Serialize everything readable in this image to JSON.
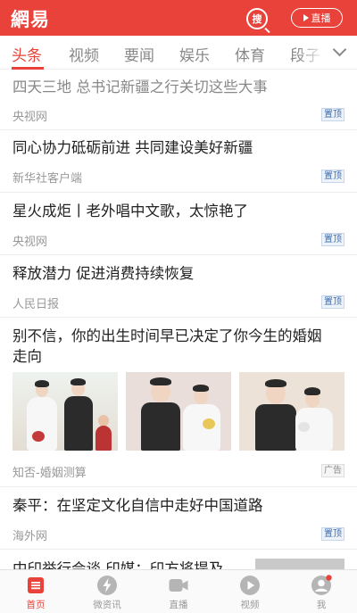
{
  "header": {
    "logo": "網易",
    "search_label": "搜",
    "live_label": "直播",
    "brand_color": "#e8423a"
  },
  "tabs": [
    {
      "label": "头条",
      "active": true
    },
    {
      "label": "视频",
      "active": false
    },
    {
      "label": "要闻",
      "active": false
    },
    {
      "label": "娱乐",
      "active": false
    },
    {
      "label": "体育",
      "active": false
    },
    {
      "label": "段子",
      "active": false
    }
  ],
  "feed": [
    {
      "title": "四天三地 总书记新疆之行关切这些大事",
      "source": "央视网",
      "tag": "置顶",
      "read": true
    },
    {
      "title": "同心协力砥砺前进 共同建设美好新疆",
      "source": "新华社客户端",
      "tag": "置顶",
      "read": false
    },
    {
      "title": "星火成炬丨老外唱中文歌，太惊艳了",
      "source": "央视网",
      "tag": "置顶",
      "read": false
    },
    {
      "title": " 释放潜力 促进消费持续恢复",
      "source": "人民日报",
      "tag": "置顶",
      "read": false
    },
    {
      "title_line1": "别不信，你的出生时间早已决定了你今生的婚姻",
      "title_line2": "走向",
      "source": "知否-婚姻测算",
      "tag": "广告"
    },
    {
      "title": "秦平：在坚定文化自信中走好中国道路",
      "source": "海外网",
      "tag": "置顶",
      "read": false
    },
    {
      "title": "中印举行会谈 印媒：印方将提及",
      "source": "",
      "tag": ""
    }
  ],
  "bottom_nav": [
    {
      "label": "首页",
      "icon": "home-icon",
      "active": true
    },
    {
      "label": "微资讯",
      "icon": "lightning-icon",
      "active": false
    },
    {
      "label": "直播",
      "icon": "video-camera-icon",
      "active": false
    },
    {
      "label": "视频",
      "icon": "play-icon",
      "active": false
    },
    {
      "label": "我",
      "icon": "user-icon",
      "active": false
    }
  ]
}
